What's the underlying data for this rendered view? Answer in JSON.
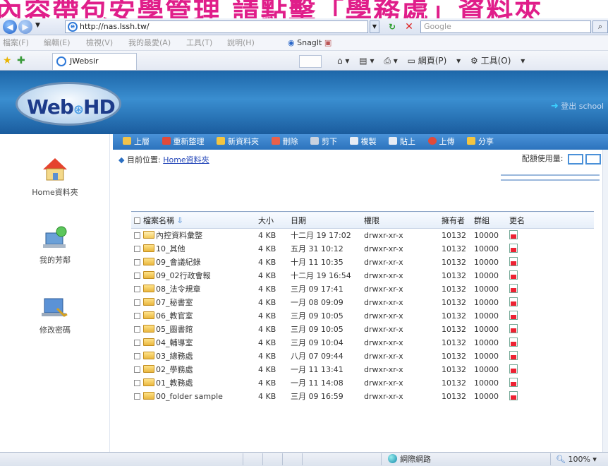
{
  "banner_text": "內容帶包安學管理 請點擊「學務處」資料夾",
  "browser": {
    "url": "http://nas.lssh.tw/",
    "search_placeholder": "Google",
    "menu": [
      "檔案(F)",
      "編輯(E)",
      "檢視(V)",
      "我的最愛(A)",
      "工具(T)",
      "說明(H)"
    ],
    "snagit_label": "SnagIt",
    "tab_title": "JWebsir",
    "cmd_page": "網頁(P)",
    "cmd_tools": "工具(O)",
    "status_zone": "網際網路",
    "status_zoom": "100%"
  },
  "app": {
    "logo_text_web": "Web",
    "logo_text_hd": "HD",
    "logout_label": "登出 school"
  },
  "sidebar": {
    "items": [
      {
        "label": "Home資料夾",
        "icon": "home-icon"
      },
      {
        "label": "我的芳鄰",
        "icon": "network-neighborhood-icon"
      },
      {
        "label": "修改密碼",
        "icon": "change-password-icon"
      }
    ]
  },
  "toolbar": {
    "buttons": [
      "上層",
      "重新整理",
      "新資料夾",
      "刪除",
      "剪下",
      "複製",
      "貼上",
      "上傳",
      "分享"
    ]
  },
  "location": {
    "label": "目前位置:",
    "path": "Home資料夾"
  },
  "quota_label": "配額使用量:",
  "table": {
    "headers": [
      "檔案名稱",
      "大小",
      "日期",
      "權限",
      "擁有者",
      "群組",
      "更名"
    ],
    "rows": [
      {
        "name": "內控資料彙整",
        "size": "4 KB",
        "date": "十二月 19 17:02",
        "perm": "drwxr-xr-x",
        "owner": "10132",
        "group": "10000",
        "open": true
      },
      {
        "name": "10_其他",
        "size": "4 KB",
        "date": "五月 31 10:12",
        "perm": "drwxr-xr-x",
        "owner": "10132",
        "group": "10000",
        "open": false
      },
      {
        "name": "09_會議紀錄",
        "size": "4 KB",
        "date": "十月 11 10:35",
        "perm": "drwxr-xr-x",
        "owner": "10132",
        "group": "10000",
        "open": false
      },
      {
        "name": "09_02行政會報",
        "size": "4 KB",
        "date": "十二月 19 16:54",
        "perm": "drwxr-xr-x",
        "owner": "10132",
        "group": "10000",
        "open": false
      },
      {
        "name": "08_法令規章",
        "size": "4 KB",
        "date": "三月 09 17:41",
        "perm": "drwxr-xr-x",
        "owner": "10132",
        "group": "10000",
        "open": false
      },
      {
        "name": "07_秘書室",
        "size": "4 KB",
        "date": "一月 08 09:09",
        "perm": "drwxr-xr-x",
        "owner": "10132",
        "group": "10000",
        "open": false
      },
      {
        "name": "06_教官室",
        "size": "4 KB",
        "date": "三月 09 10:05",
        "perm": "drwxr-xr-x",
        "owner": "10132",
        "group": "10000",
        "open": false
      },
      {
        "name": "05_圖書館",
        "size": "4 KB",
        "date": "三月 09 10:05",
        "perm": "drwxr-xr-x",
        "owner": "10132",
        "group": "10000",
        "open": false
      },
      {
        "name": "04_輔導室",
        "size": "4 KB",
        "date": "三月 09 10:04",
        "perm": "drwxr-xr-x",
        "owner": "10132",
        "group": "10000",
        "open": false
      },
      {
        "name": "03_總務處",
        "size": "4 KB",
        "date": "八月 07 09:44",
        "perm": "drwxr-xr-x",
        "owner": "10132",
        "group": "10000",
        "open": false
      },
      {
        "name": "02_學務處",
        "size": "4 KB",
        "date": "一月 11 13:41",
        "perm": "drwxr-xr-x",
        "owner": "10132",
        "group": "10000",
        "open": false
      },
      {
        "name": "01_教務處",
        "size": "4 KB",
        "date": "一月 11 14:08",
        "perm": "drwxr-xr-x",
        "owner": "10132",
        "group": "10000",
        "open": false
      },
      {
        "name": "00_folder sample",
        "size": "4 KB",
        "date": "三月 09 16:59",
        "perm": "drwxr-xr-x",
        "owner": "10132",
        "group": "10000",
        "open": false
      }
    ]
  },
  "colors": {
    "banner": "#e01e8a",
    "header_blue": "#2c73bd",
    "link_blue": "#2346b8"
  }
}
